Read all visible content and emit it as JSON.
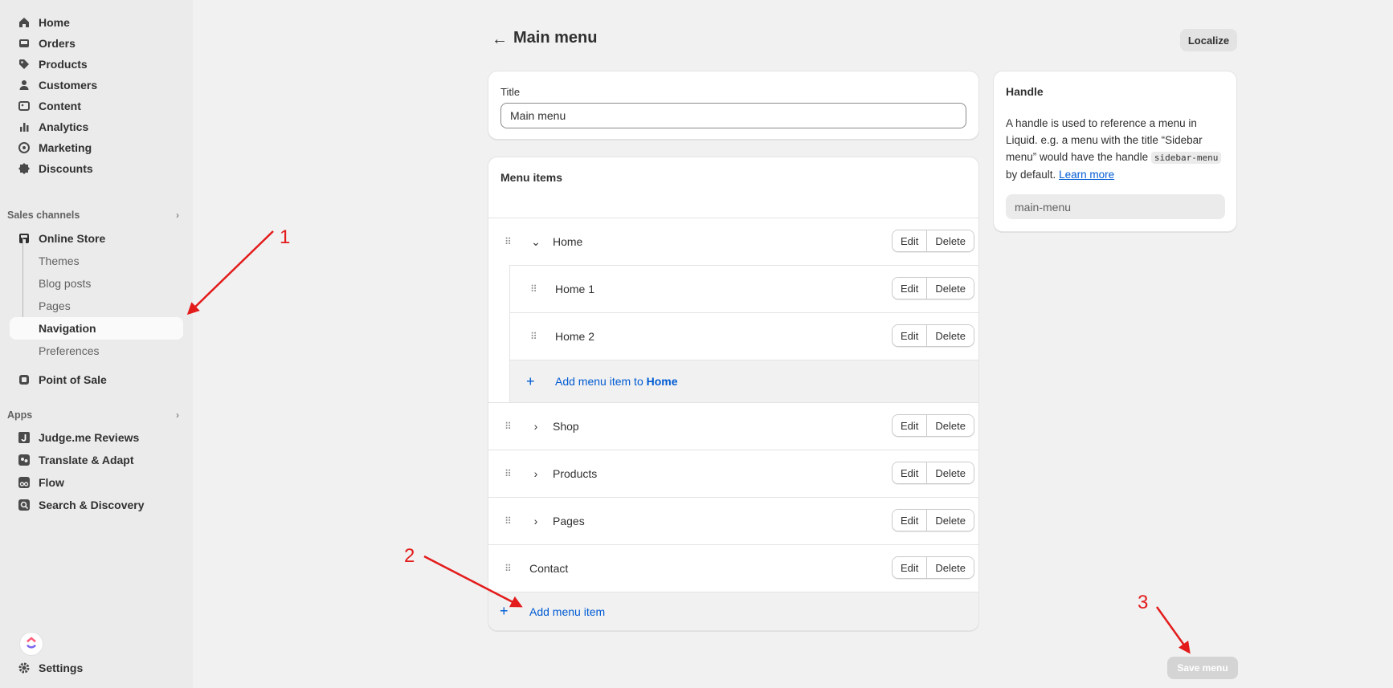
{
  "sidebar": {
    "main_items": [
      {
        "label": "Home",
        "icon": "home-icon"
      },
      {
        "label": "Orders",
        "icon": "inbox-icon"
      },
      {
        "label": "Products",
        "icon": "tag-icon"
      },
      {
        "label": "Customers",
        "icon": "person-icon"
      },
      {
        "label": "Content",
        "icon": "image-icon"
      },
      {
        "label": "Analytics",
        "icon": "bar-chart-icon"
      },
      {
        "label": "Marketing",
        "icon": "target-icon"
      },
      {
        "label": "Discounts",
        "icon": "discount-icon"
      }
    ],
    "sales_channels_label": "Sales channels",
    "online_store": {
      "label": "Online Store",
      "icon": "store-icon"
    },
    "online_store_sub": [
      "Themes",
      "Blog posts",
      "Pages",
      "Navigation",
      "Preferences"
    ],
    "active_sub": "Navigation",
    "point_of_sale": {
      "label": "Point of Sale",
      "icon": "pos-icon"
    },
    "apps_label": "Apps",
    "apps": [
      {
        "label": "Judge.me Reviews",
        "icon": "judgeme-icon"
      },
      {
        "label": "Translate & Adapt",
        "icon": "translate-icon"
      },
      {
        "label": "Flow",
        "icon": "flow-icon"
      },
      {
        "label": "Search & Discovery",
        "icon": "search-discovery-icon"
      }
    ],
    "settings": {
      "label": "Settings",
      "icon": "gear-icon"
    }
  },
  "header": {
    "title": "Main menu",
    "localize_label": "Localize"
  },
  "title_card": {
    "label": "Title",
    "value": "Main menu"
  },
  "menu_card": {
    "heading": "Menu items",
    "edit_label": "Edit",
    "delete_label": "Delete",
    "items": [
      {
        "name": "Home",
        "level": 0,
        "toggle": "expanded"
      },
      {
        "name": "Home 1",
        "level": 1,
        "toggle": "none"
      },
      {
        "name": "Home 2",
        "level": 1,
        "toggle": "none"
      },
      {
        "name": "Shop",
        "level": 0,
        "toggle": "collapsed"
      },
      {
        "name": "Products",
        "level": 0,
        "toggle": "collapsed"
      },
      {
        "name": "Pages",
        "level": 0,
        "toggle": "collapsed"
      },
      {
        "name": "Contact",
        "level": 0,
        "toggle": "none"
      }
    ],
    "add_child_prefix": "Add menu item to",
    "add_child_target": "Home",
    "add_root_label": "Add menu item"
  },
  "handle_card": {
    "heading": "Handle",
    "desc_part1": "A handle is used to reference a menu in Liquid. e.g. a menu with the title “Sidebar menu” would have the handle",
    "desc_code": "sidebar-menu",
    "desc_part2": "by default.",
    "learn_more": "Learn more",
    "value": "main-menu"
  },
  "save_label": "Save menu",
  "annotations": [
    "1",
    "2",
    "3"
  ],
  "colors": {
    "annotation": "#e31b1b",
    "link": "#005bd3"
  }
}
